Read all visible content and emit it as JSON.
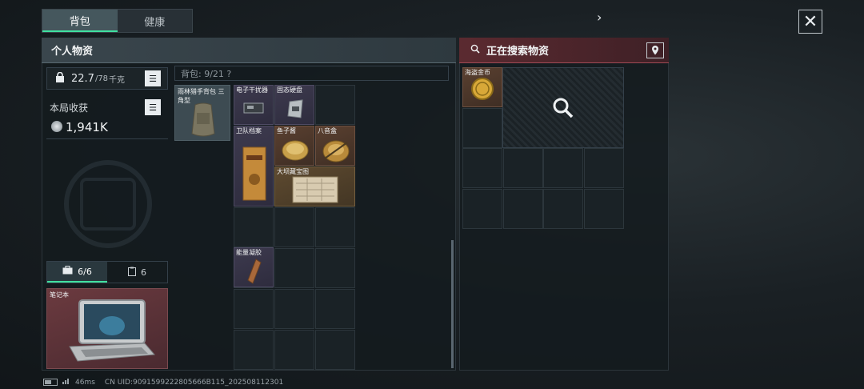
{
  "tabs": [
    {
      "label": "背包"
    },
    {
      "label": "健康"
    }
  ],
  "close_label": "✕",
  "left_panel": {
    "title": "个人物资",
    "weight": {
      "current": "22.7",
      "max": "/78",
      "unit": "千克"
    },
    "income": {
      "label": "本局收获",
      "value": "1,941K"
    },
    "secure_tabs": [
      {
        "label": "6/6"
      },
      {
        "label": "6"
      }
    ],
    "laptop": {
      "label": "笔记本"
    }
  },
  "backpack": {
    "header": "背包: 9/21 ?",
    "bag_item": {
      "label": "雨林猎手背包 三角型"
    },
    "items": [
      {
        "label": "电子干扰器",
        "rarity": "purple"
      },
      {
        "label": "固态硬盘",
        "rarity": "purple"
      },
      {
        "label": "卫队档案",
        "rarity": "purple"
      },
      {
        "label": "鱼子酱",
        "rarity": "orange"
      },
      {
        "label": "八音盒",
        "rarity": "orange"
      },
      {
        "label": "大坝藏宝图",
        "rarity": "gold"
      },
      {
        "label": "能量凝胶",
        "rarity": "purple"
      }
    ]
  },
  "right_panel": {
    "title": "正在搜索物资",
    "found_item": {
      "label": "海盗金币"
    }
  },
  "status_bar": {
    "ping": "46ms",
    "uid": "CN UID:9091599222805666B115_202508112301"
  },
  "colors": {
    "accent": "#40e0a0",
    "search_header": "#5b2a30",
    "purple": "#3d3a4e",
    "orange": "#5a4030"
  }
}
